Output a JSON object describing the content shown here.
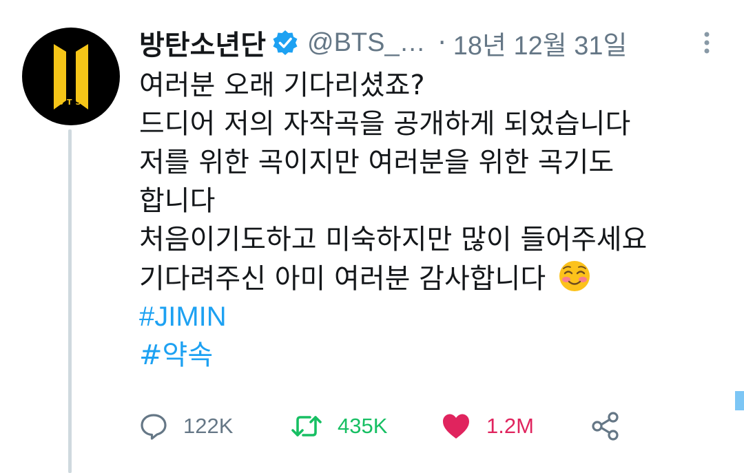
{
  "tweet": {
    "author": {
      "display_name": "방탄소년단",
      "handle": "@BTS_…",
      "verified": true,
      "avatar_text": "BTS"
    },
    "separator": "·",
    "date": "18년 12월 31일",
    "lines": [
      "여러분 오래 기다리셨죠?",
      "드디어 저의 자작곡을 공개하게 되었습니다",
      "저를 위한 곡이지만 여러분을 위한 곡기도",
      "합니다",
      "처음이기도하고 미숙하지만 많이 들어주세요",
      "기다려주신 아미 여러분 감사합니다"
    ],
    "emoji": "smiling-face-with-blush",
    "hashtags": [
      "#JIMIN",
      "#약속"
    ]
  },
  "actions": {
    "reply_count": "122K",
    "retweet_count": "435K",
    "like_count": "1.2M",
    "liked": true
  },
  "colors": {
    "accent": "#1da1f2",
    "retweet_green": "#17bf63",
    "like_red": "#e0245e",
    "muted": "#657786",
    "logo_gold": "#f5c518"
  }
}
